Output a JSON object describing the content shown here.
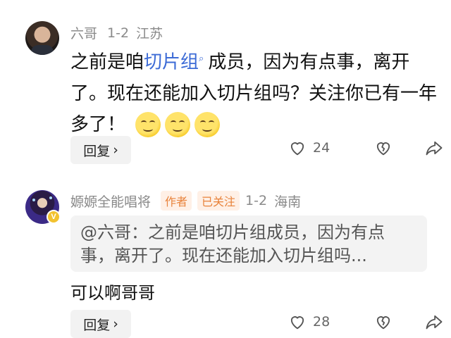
{
  "comment1": {
    "author": "六哥",
    "date": "1-2",
    "location": "江苏",
    "text_before": "之前是咱",
    "link_text": "切片组",
    "link_icon": "search-icon",
    "text_after": "成员，因为有点事，离开了。现在还能加入切片组吗？关注你已有一年多了！",
    "emojis": [
      "smile-emoji",
      "smile-emoji",
      "smile-emoji"
    ],
    "reply_label": "回复",
    "like_count": "24"
  },
  "comment2": {
    "author": "嫄嫄全能唱将",
    "author_badge": "V",
    "tag_author": "作者",
    "tag_followed": "已关注",
    "date": "1-2",
    "location": "海南",
    "quote": "@六哥：之前是咱切片组成员，因为有点事，离开了。现在还能加入切片组吗...",
    "text": "可以啊哥哥",
    "reply_label": "回复",
    "like_count": "28"
  },
  "colors": {
    "link": "#3c6bd6",
    "tag_bg": "#fff0e6",
    "tag_text": "#e8823a",
    "meta": "#8a8a8a"
  }
}
